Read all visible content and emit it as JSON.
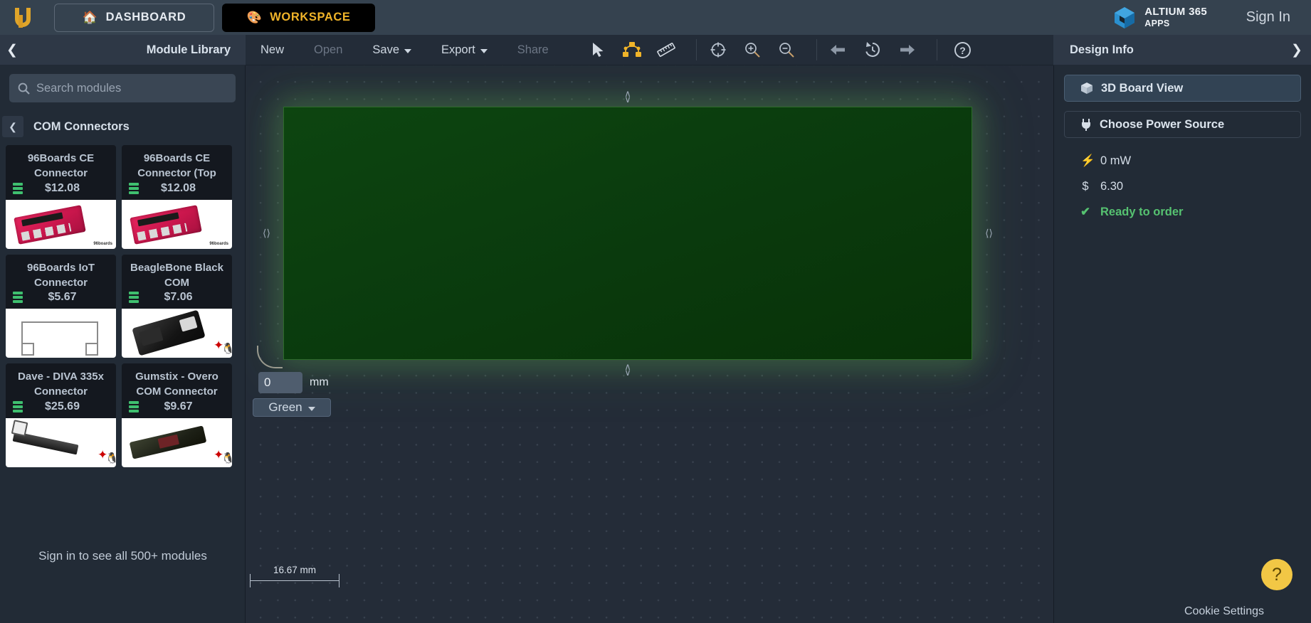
{
  "header": {
    "logo_name": "upverter-logo",
    "dashboard_label": "DASHBOARD",
    "workspace_label": "WORKSPACE",
    "altium_title": "ALTIUM 365",
    "altium_sub": "APPS",
    "signin_label": "Sign In",
    "accent_yellow": "#f0b429",
    "bar_bg": "#35424f"
  },
  "library_panel": {
    "title": "Module Library",
    "collapse_icon": "chevron-left-icon",
    "search_placeholder": "Search modules",
    "search_value": "",
    "category": "COM Connectors",
    "signin_note": "Sign in to see all 500+ modules",
    "modules": [
      {
        "name": "96Boards CE Connector",
        "price": "$12.08",
        "thumb": "board96",
        "watermark": "96boards"
      },
      {
        "name": "96Boards CE Connector (Top",
        "price": "$12.08",
        "thumb": "board96",
        "watermark": "96boards"
      },
      {
        "name": "96Boards IoT Connector",
        "price": "$5.67",
        "thumb": "connector-drawing",
        "watermark": ""
      },
      {
        "name": "BeagleBone Black COM",
        "price": "$7.06",
        "thumb": "beaglebone",
        "watermark": "ti-linux"
      },
      {
        "name": "Dave - DIVA 335x Connector",
        "price": "$25.69",
        "thumb": "stick",
        "watermark": "ti-linux"
      },
      {
        "name": "Gumstix - Overo COM Connector",
        "price": "$9.67",
        "thumb": "overo",
        "watermark": "ti-linux"
      }
    ]
  },
  "toolbar": {
    "menu": [
      {
        "label": "New",
        "disabled": false,
        "caret": false
      },
      {
        "label": "Open",
        "disabled": true,
        "caret": false
      },
      {
        "label": "Save",
        "disabled": false,
        "caret": true
      },
      {
        "label": "Export",
        "disabled": false,
        "caret": true
      },
      {
        "label": "Share",
        "disabled": true,
        "caret": false
      }
    ],
    "tools": [
      {
        "icon": "cursor-arrow-icon",
        "active": false
      },
      {
        "icon": "route-nets-icon",
        "active": true
      },
      {
        "icon": "ruler-measure-icon",
        "active": false
      }
    ],
    "view_tools": [
      {
        "icon": "fit-to-screen-icon"
      },
      {
        "icon": "zoom-in-icon"
      },
      {
        "icon": "zoom-out-icon"
      }
    ],
    "history_tools": [
      {
        "icon": "undo-icon"
      },
      {
        "icon": "history-icon"
      },
      {
        "icon": "redo-icon"
      }
    ],
    "help": {
      "icon": "help-circle-icon"
    }
  },
  "canvas": {
    "board_color_hex": "#0a3a0d",
    "corner_radius_value": "0",
    "corner_radius_unit": "mm",
    "corner_radius_icon": "corner-radius-icon",
    "color_select_value": "Green",
    "color_select_caret": "chevron-down-icon",
    "dimension_label": "16.67 mm",
    "handles": {
      "top": "resize-handle-vertical",
      "bottom": "resize-handle-vertical",
      "left": "resize-handle-horizontal",
      "right": "resize-handle-horizontal"
    }
  },
  "design_info": {
    "title": "Design Info",
    "expand_icon": "chevron-right-icon",
    "board_view_label": "3D Board View",
    "board_view_icon": "cube-icon",
    "power_source_label": "Choose Power Source",
    "power_source_icon": "plug-icon",
    "stats": [
      {
        "icon": "bolt-icon",
        "glyph": "⚡",
        "value": "0 mW",
        "status": false
      },
      {
        "icon": "dollar-icon",
        "glyph": "$",
        "value": "6.30",
        "status": false
      },
      {
        "icon": "check-icon",
        "glyph": "✔",
        "value": "Ready to order",
        "status": true
      }
    ],
    "status_green": "#56c271"
  },
  "footer": {
    "cookie_label": "Cookie Settings",
    "help_fab_label": "?"
  }
}
